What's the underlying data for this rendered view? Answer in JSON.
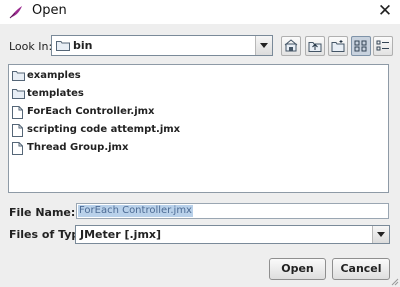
{
  "window": {
    "title": "Open",
    "close_glyph": "✕"
  },
  "look_in": {
    "label": "Look In:",
    "value": "bin"
  },
  "toolbar": {
    "buttons": [
      {
        "name": "home-folder-button",
        "icon": "home-icon"
      },
      {
        "name": "up-one-level-button",
        "icon": "up-folder-icon"
      },
      {
        "name": "new-folder-button",
        "icon": "new-folder-icon"
      },
      {
        "name": "list-view-button",
        "icon": "list-view-icon",
        "pressed": true
      },
      {
        "name": "details-view-button",
        "icon": "details-view-icon",
        "pressed": false
      }
    ]
  },
  "files": [
    {
      "name": "examples",
      "kind": "folder"
    },
    {
      "name": "templates",
      "kind": "folder"
    },
    {
      "name": "ForEach Controller.jmx",
      "kind": "file"
    },
    {
      "name": "scripting code attempt.jmx",
      "kind": "file"
    },
    {
      "name": "Thread Group.jmx",
      "kind": "file"
    }
  ],
  "file_name": {
    "label": "File Name:",
    "value": "ForEach Controller.jmx"
  },
  "file_type": {
    "label": "Files of Type:",
    "value": "JMeter [.jmx]"
  },
  "buttons": {
    "open": "Open",
    "cancel": "Cancel"
  },
  "colors": {
    "accent": "#9b2a8f",
    "selection": "#b9d1ea"
  }
}
